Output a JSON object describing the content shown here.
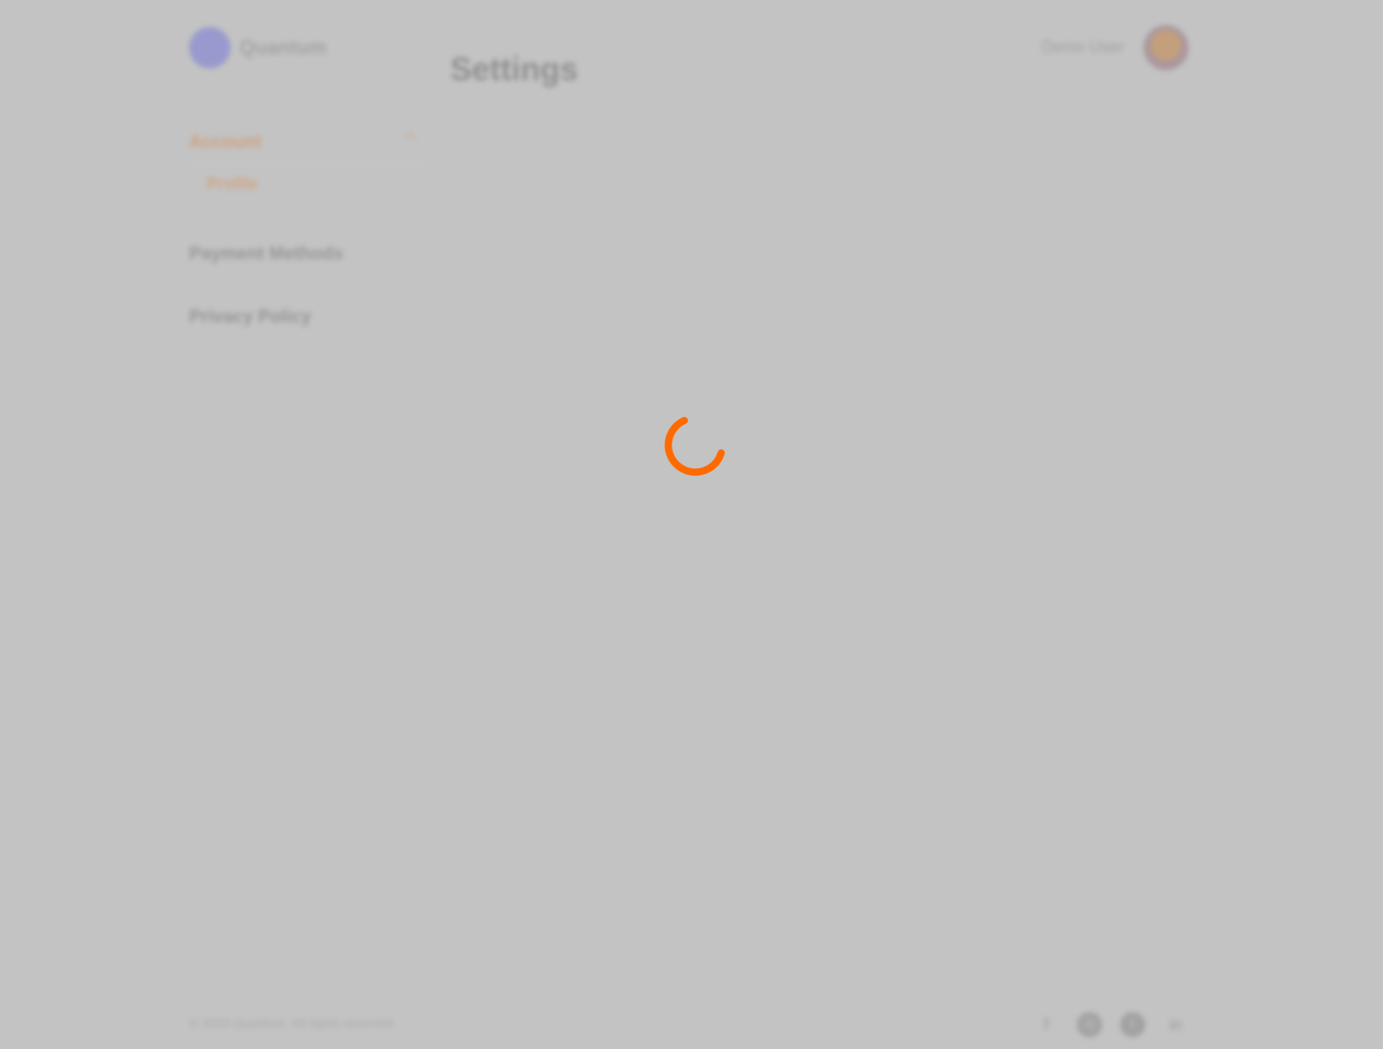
{
  "app": {
    "logo_text": "Quantum",
    "page_title": "Settings",
    "user_name": "Demo User"
  },
  "sidebar": {
    "active_section": "Account",
    "active_sub_item": "Profile",
    "items": [
      "Payment Methods",
      "Privacy Policy"
    ]
  },
  "footer": {
    "copyright": "© 2024 Quantum. All rights reserved."
  },
  "icons": {
    "chevron": "chevron-up-icon",
    "social": [
      "facebook-icon",
      "instagram-icon",
      "twitter-icon",
      "linkedin-icon"
    ]
  },
  "colors": {
    "background": "#c3c3c3",
    "accent": "#ff6a00",
    "brand": "#7b7fd6"
  }
}
